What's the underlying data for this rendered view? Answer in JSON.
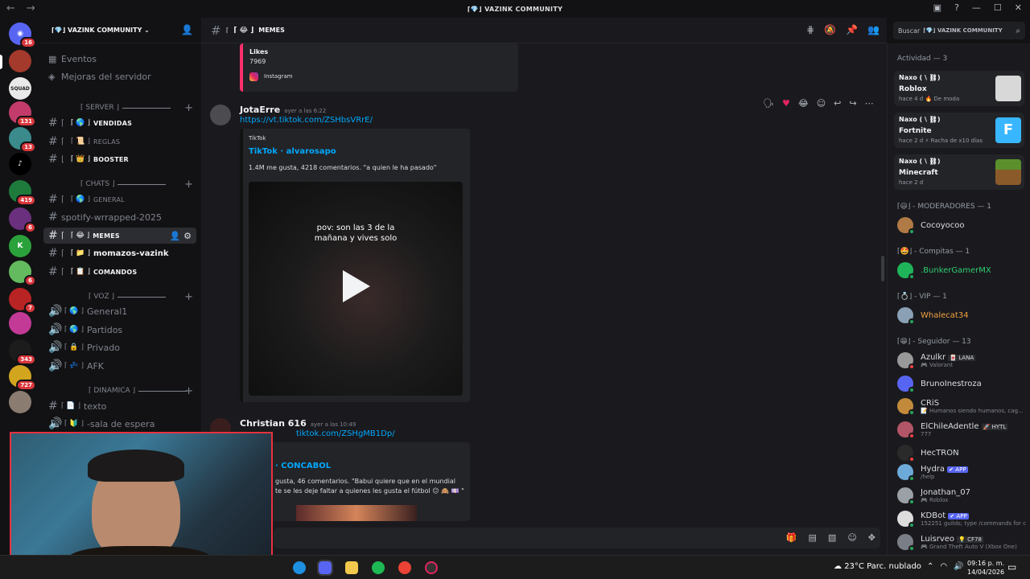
{
  "window": {
    "title": "⌈💎⌋ VAZINK COMMUNITY"
  },
  "servers": [
    {
      "badge": "16"
    },
    {
      "badge": ""
    },
    {
      "badge": ""
    },
    {
      "badge": "131"
    },
    {
      "badge": "13"
    },
    {
      "badge": ""
    },
    {
      "badge": "419"
    },
    {
      "badge": "6"
    },
    {
      "badge": ""
    },
    {
      "badge": "6"
    },
    {
      "badge": "7"
    },
    {
      "badge": ""
    },
    {
      "badge": "343"
    },
    {
      "badge": "727"
    },
    {
      "badge": ""
    }
  ],
  "guild": {
    "name": "⌈💎⌋ VAZINK COMMUNITY ⌄"
  },
  "sidebar": {
    "eventos": "Eventos",
    "mejoras": "Mejoras del servidor",
    "cat_server": "⌈ SERVER ⌋",
    "ventas": "VENDIDAS",
    "ventas_pre": "⌈ 🌎 ⌋",
    "reglas": "REGLAS",
    "reglas_pre": "⌈ 📜 ⌋",
    "booster": "BOOSTER",
    "booster_pre": "⌈ 👑 ⌋",
    "cat_chats": "⌈ CHATS ⌋",
    "general": "GENERAL",
    "general_pre": "⌈ 🌎 ⌋",
    "spotify": "spotify-wrrapped-2025",
    "memes": "MEMES",
    "memes_pre": "⌈ 😂 ⌋",
    "momazos": "momazos-vazink",
    "momazos_pre": "⌈ 📁 ⌋",
    "comandos": "COMANDOS",
    "comandos_pre": "⌈ 📋 ⌋",
    "cat_voz": "⌈ VOZ ⌋",
    "general1": "General1",
    "general1_pre": "⌈ 🌎 ⌋",
    "partidos": "Partidos",
    "partidos_pre": "⌈ 🌎 ⌋",
    "privado": "Privado",
    "privado_pre": "⌈ 🔒 ⌋",
    "afk": "AFK",
    "afk_pre": "⌈ 💤 ⌋",
    "cat_dinamica": "⌈ DINAMICA ⌋",
    "texto": "texto",
    "texto_pre": "⌈ 📄 ⌋",
    "espera": "-sala de espera",
    "espera_pre": "⌈ 🔰 ⌋"
  },
  "channel_header": {
    "prefix": "⌈ 😂 ⌋",
    "name": "MEMES"
  },
  "search": {
    "placeholder": "Buscar",
    "scope": "⌈💎⌋ VAZINK COMMUNITY"
  },
  "messages": [
    {
      "embed_likes_label": "Likes",
      "embed_likes_value": "7969",
      "embed_provider": "Instagram"
    },
    {
      "author": "JotaErre",
      "time": "ayer a las 6:22",
      "link": "https://vt.tiktok.com/ZSHbsVRrE/",
      "embed_provider": "TikTok",
      "embed_title": "TikTok · alvarosapo",
      "embed_desc": "1.4M me gusta, 4218 comentarios. \"a quien le ha pasado\"",
      "video_caption_1": "pov: son las 3 de la",
      "video_caption_2": "mañana y vives solo"
    },
    {
      "author": "Christian 616",
      "time": "ayer a las 10:49",
      "link": "tiktok.com/ZSHgMB1Dp/",
      "embed_title": "· CONCABOL",
      "embed_desc_1": "gusta, 46 comentarios. \"Babui quiere que en el mundial",
      "embed_desc_2": "te se les deje faltar a quienes les gusta el fútbol 😐 🙈 💷 \""
    }
  ],
  "members": {
    "activity_header": "Actividad — 3",
    "activities": [
      {
        "user": "Naxo ( \\ ⛓)",
        "game": "Roblox",
        "detail": "hace 4 d   🔥 De moda"
      },
      {
        "user": "Naxo ( \\ ⛓)",
        "game": "Fortnite",
        "detail": "hace 2 d   ⚡ Racha de x10 días"
      },
      {
        "user": "Naxo ( \\ ⛓)",
        "game": "Minecraft",
        "detail": "hace 2 d"
      }
    ],
    "groups": [
      {
        "label": "⌈😃⌋ - MODERADORES — 1",
        "members": [
          {
            "name": "Cocoyocoo",
            "sub": ""
          }
        ]
      },
      {
        "label": "⌈🤩⌋ - Compitas — 1",
        "members": [
          {
            "name": ".BunkerGamerMX",
            "sub": ""
          }
        ]
      },
      {
        "label": "⌈💍⌋ - VIP — 1",
        "members": [
          {
            "name": "Whalecat34",
            "sub": ""
          }
        ]
      },
      {
        "label": "⌈😁⌋ - Seguidor — 13",
        "members": [
          {
            "name": "Azulkr",
            "tag": "🀄 LANA",
            "sub": "🎮 Valorant"
          },
          {
            "name": "BrunoInestroza",
            "sub": ""
          },
          {
            "name": "CRiS",
            "sub": "📝 Humanos siendo humanos, cag..."
          },
          {
            "name": "ElChileAdentle",
            "tag": "🚀 HYTL",
            "sub": "777"
          },
          {
            "name": "HecTRON",
            "sub": ""
          },
          {
            "name": "Hydra",
            "tag": "✔ APP",
            "sub": "/help"
          },
          {
            "name": "Jonathan_07",
            "sub": "🎮 Roblox"
          },
          {
            "name": "KDBot",
            "tag": "✔ APP",
            "sub": "152251 guilds; type /commands for c"
          },
          {
            "name": "Luisrveo",
            "tag": "💡 CF78",
            "sub": "🎮 Grand Theft Auto V (Xbox One)"
          }
        ]
      }
    ]
  },
  "taskbar": {
    "weather": "23°C  Parc. nublado",
    "time": "09:16 p. m.",
    "date": "14/04/2026"
  },
  "colors": {
    "accent": "#5865f2",
    "link": "#00a8fc",
    "instagram": "#ff2f6c",
    "webcam_border": "#e7323f"
  }
}
